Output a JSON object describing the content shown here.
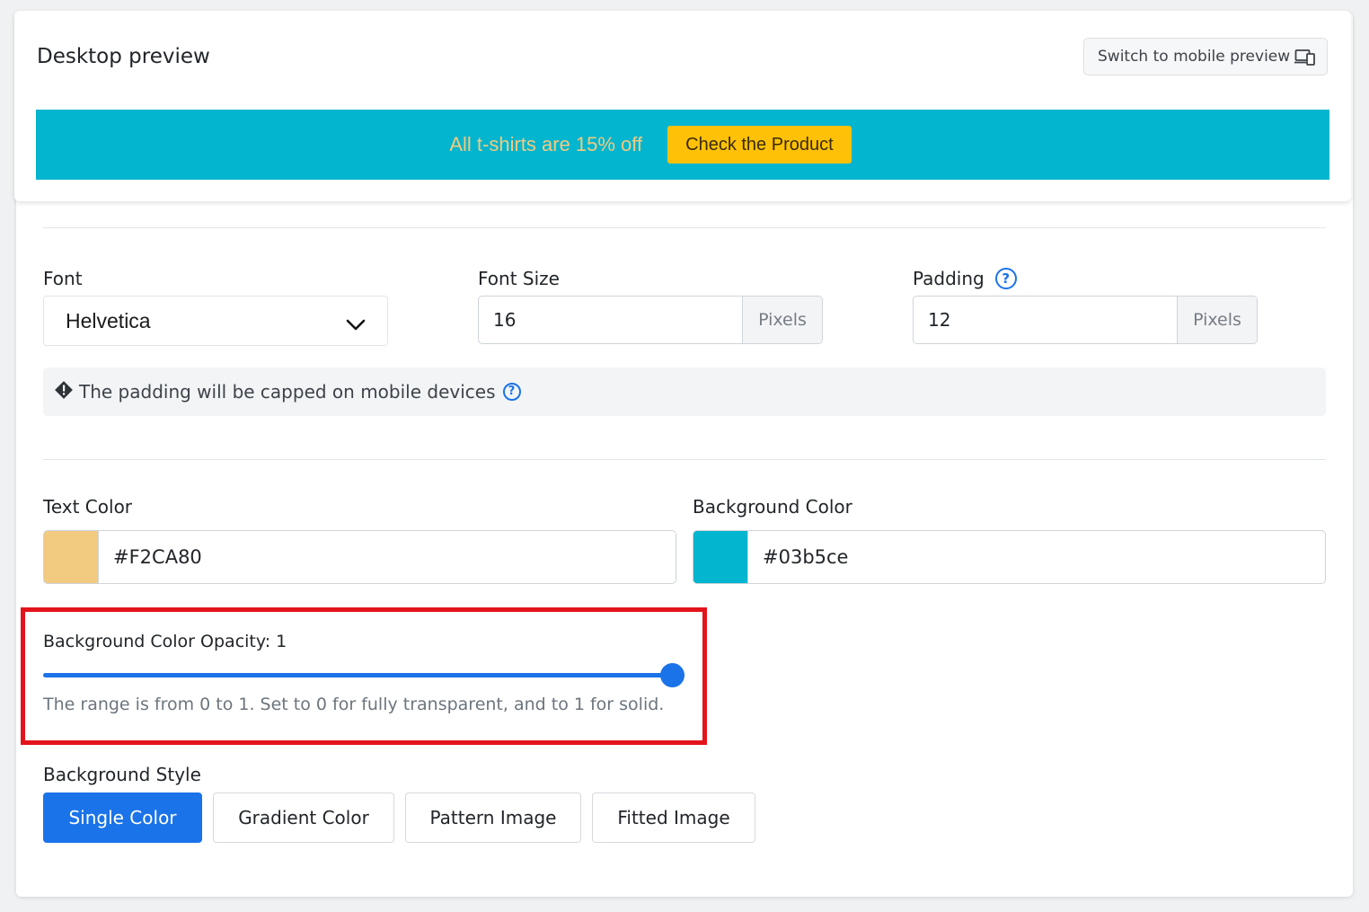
{
  "preview": {
    "title": "Desktop preview",
    "switch_label": "Switch to mobile preview",
    "switch_icon": "devices-icon"
  },
  "banner": {
    "text": "All t-shirts are 15% off",
    "cta": "Check the Product",
    "text_color": "#F2CA80",
    "bg_color": "#03b5ce",
    "cta_color": "#ffc107"
  },
  "font": {
    "label": "Font",
    "value": "Helvetica"
  },
  "font_size": {
    "label": "Font Size",
    "value": "16",
    "unit": "Pixels"
  },
  "padding": {
    "label": "Padding",
    "value": "12",
    "unit": "Pixels"
  },
  "notice": {
    "text": "The padding will be capped on mobile devices"
  },
  "text_color": {
    "label": "Text Color",
    "value": "#F2CA80",
    "swatch": "#F2CA80"
  },
  "background_color": {
    "label": "Background Color",
    "value": "#03b5ce",
    "swatch": "#03b5ce"
  },
  "opacity": {
    "label": "Background Color Opacity: 1",
    "value": 1,
    "help": "The range is from 0 to 1. Set to 0 for fully transparent, and to 1 for solid."
  },
  "background_style": {
    "label": "Background Style",
    "options": [
      "Single Color",
      "Gradient Color",
      "Pattern Image",
      "Fitted Image"
    ],
    "selected": "Single Color"
  },
  "accent_color": "#1a73e8",
  "highlight_color": "#e3141b"
}
